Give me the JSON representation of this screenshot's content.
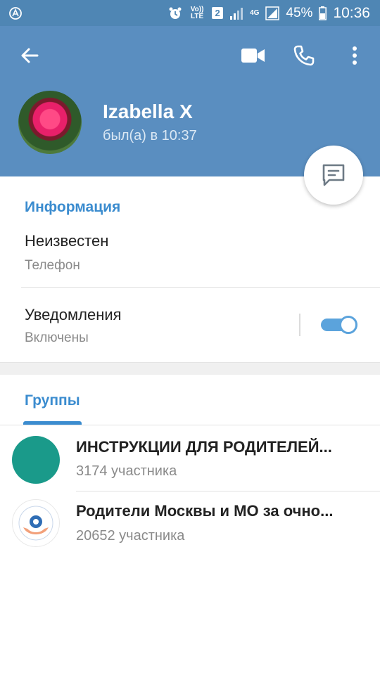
{
  "statusbar": {
    "volte": "Vo)) LTE",
    "sim": "2",
    "network": "4G",
    "battery": "45%",
    "time": "10:36"
  },
  "header": {
    "name": "Izabella X",
    "last_seen": "был(а) в 10:37"
  },
  "info": {
    "section_title": "Информация",
    "phone_value": "Неизвестен",
    "phone_label": "Телефон",
    "notifications_title": "Уведомления",
    "notifications_state": "Включены",
    "notifications_on": true
  },
  "groups": {
    "tab_label": "Группы",
    "items": [
      {
        "name": "ИНСТРУКЦИИ ДЛЯ РОДИТЕЛЕЙ...",
        "members": "3174 участника"
      },
      {
        "name": "Родители Москвы и МО за очно...",
        "members": "20652 участника"
      }
    ]
  },
  "colors": {
    "header_bg": "#5a8ec0",
    "statusbar_bg": "#4f86b4",
    "accent": "#3b8ccf",
    "toggle": "#5ba3dc"
  },
  "icons": [
    "back-arrow-icon",
    "video-call-icon",
    "phone-icon",
    "more-vert-icon",
    "message-icon"
  ]
}
